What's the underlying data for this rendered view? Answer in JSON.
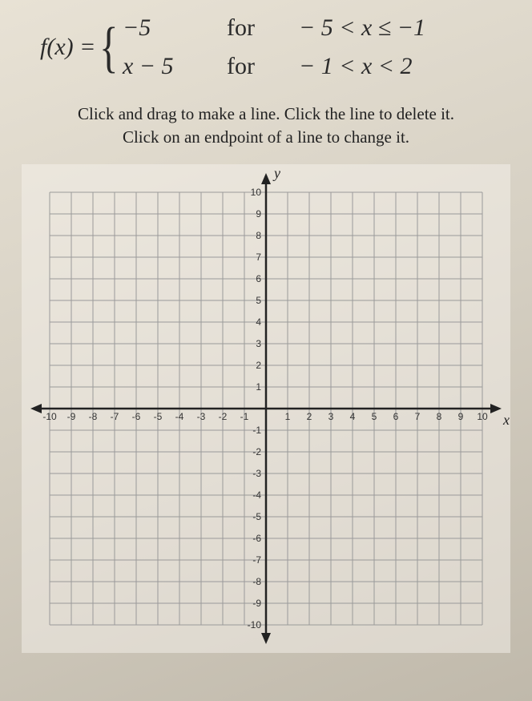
{
  "equation": {
    "lhs": "f(x) =",
    "pieces": [
      {
        "expr": "−5",
        "for": "for",
        "domain": "− 5 < x ≤ −1"
      },
      {
        "expr": "x − 5",
        "for": "for",
        "domain": "− 1 < x < 2"
      }
    ]
  },
  "instructions": {
    "line1": "Click and drag to make a line. Click the line to delete it.",
    "line2": "Click on an endpoint of a line to change it."
  },
  "chart_data": {
    "type": "grid",
    "xlabel": "x",
    "ylabel": "y",
    "xlim": [
      -10,
      10
    ],
    "ylim": [
      -10,
      10
    ],
    "xticks": [
      -10,
      -9,
      -8,
      -7,
      -6,
      -5,
      -4,
      -3,
      -2,
      -1,
      1,
      2,
      3,
      4,
      5,
      6,
      7,
      8,
      9,
      10
    ],
    "yticks": [
      -10,
      -9,
      -8,
      -7,
      -6,
      -5,
      -4,
      -3,
      -2,
      -1,
      1,
      2,
      3,
      4,
      5,
      6,
      7,
      8,
      9,
      10
    ],
    "grid": true,
    "series": []
  }
}
